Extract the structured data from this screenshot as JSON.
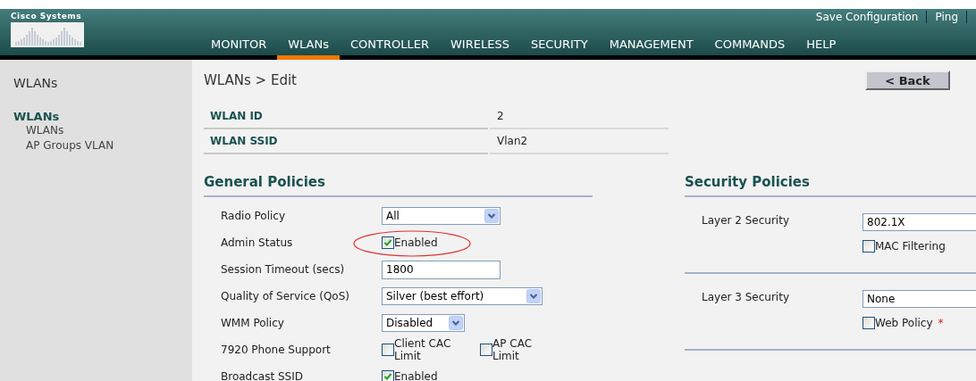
{
  "brand": {
    "name": "Cisco Systems"
  },
  "top_links": [
    "Save Configuration",
    "Ping"
  ],
  "nav": [
    {
      "label": "MONITOR",
      "selected": false
    },
    {
      "label": "WLANs",
      "selected": true
    },
    {
      "label": "CONTROLLER",
      "selected": false
    },
    {
      "label": "WIRELESS",
      "selected": false
    },
    {
      "label": "SECURITY",
      "selected": false
    },
    {
      "label": "MANAGEMENT",
      "selected": false
    },
    {
      "label": "COMMANDS",
      "selected": false
    },
    {
      "label": "HELP",
      "selected": false
    }
  ],
  "sidebar": {
    "title": "WLANs",
    "section": "WLANs",
    "items": [
      "WLANs",
      "AP Groups VLAN"
    ]
  },
  "page": {
    "breadcrumb": "WLANs > Edit",
    "back_button": "< Back"
  },
  "wlan_info": [
    {
      "label": "WLAN ID",
      "value": "2"
    },
    {
      "label": "WLAN SSID",
      "value": "Vlan2"
    }
  ],
  "general_policies": {
    "title": "General Policies",
    "rows": [
      {
        "label": "Radio Policy",
        "kind": "select",
        "value": "All"
      },
      {
        "label": "Admin Status",
        "kind": "checkbox",
        "highlighted": true,
        "checkboxes": [
          {
            "label": "Enabled",
            "checked": true
          }
        ]
      },
      {
        "label": "Session Timeout (secs)",
        "kind": "text",
        "value": "1800"
      },
      {
        "label": "Quality of Service (QoS)",
        "kind": "select",
        "value": "Silver (best effort)"
      },
      {
        "label": "WMM Policy",
        "kind": "select",
        "value": "Disabled"
      },
      {
        "label": "7920 Phone Support",
        "kind": "checkbox",
        "checkboxes": [
          {
            "label": "Client CAC Limit",
            "checked": false
          },
          {
            "label": "AP CAC Limit",
            "checked": false
          }
        ]
      },
      {
        "label": "Broadcast SSID",
        "kind": "checkbox",
        "checkboxes": [
          {
            "label": "Enabled",
            "checked": true
          }
        ]
      }
    ]
  },
  "security_policies": {
    "title": "Security Policies",
    "rows": [
      {
        "label": "Layer 2 Security",
        "value": "802.1X",
        "checkbox": {
          "label": "MAC Filtering",
          "checked": false
        }
      },
      {
        "label": "Layer 3 Security",
        "value": "None",
        "checkbox": {
          "label": "Web Policy",
          "checked": false,
          "required_mark": "*"
        }
      }
    ]
  }
}
